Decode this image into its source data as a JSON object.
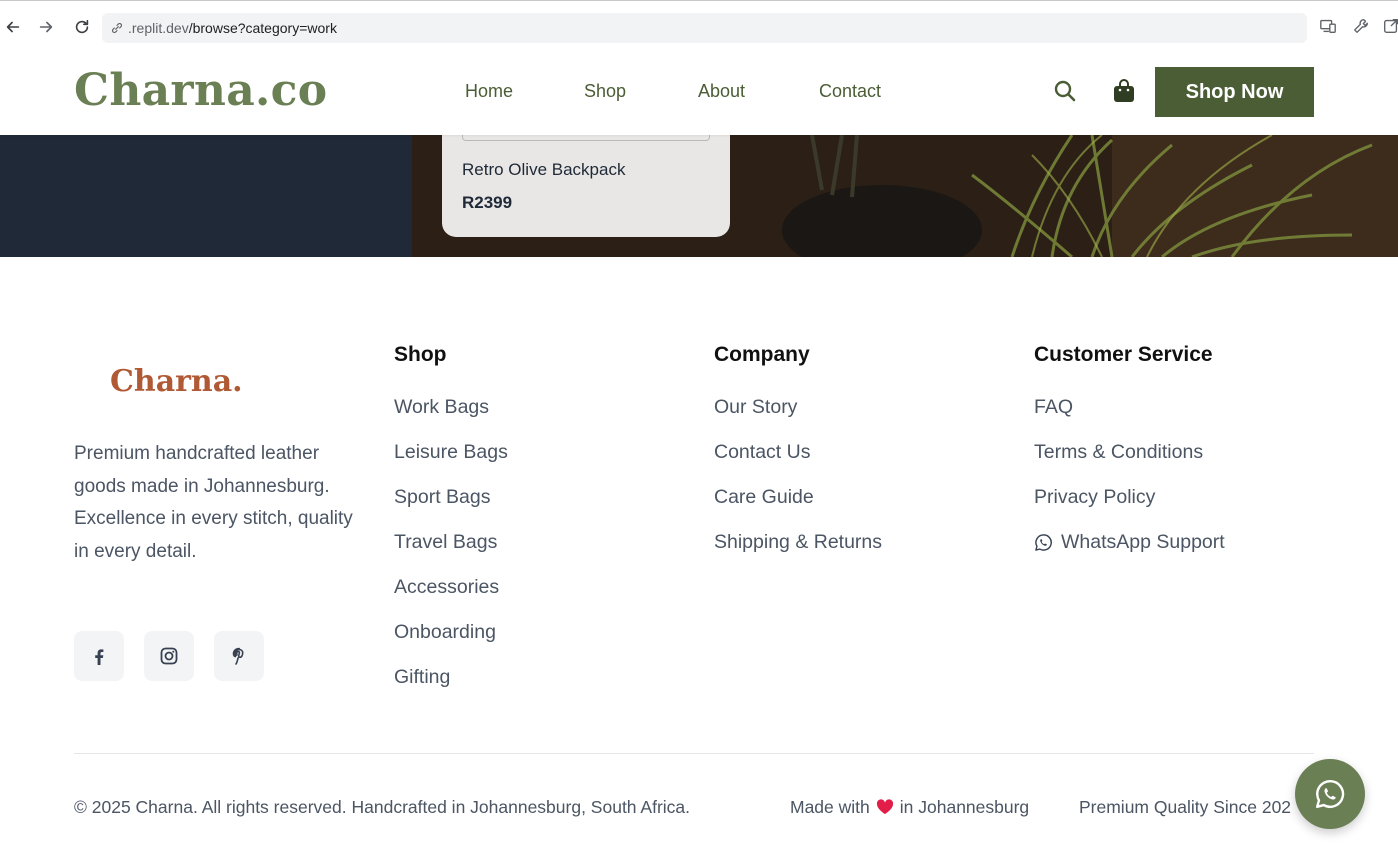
{
  "browser": {
    "url_host": ".replit.dev",
    "url_path": "/browse?category=work"
  },
  "header": {
    "logo": "Charna.co",
    "nav": [
      "Home",
      "Shop",
      "About",
      "Contact"
    ],
    "cta": "Shop Now",
    "icons": [
      "search-icon",
      "shopping-bag-icon"
    ]
  },
  "product_card": {
    "name": "Retro Olive Backpack",
    "price": "R2399"
  },
  "footer": {
    "logo": "Charna.",
    "description": "Premium handcrafted leather goods made in Johannesburg. Excellence in every stitch, quality in every detail.",
    "social": [
      "facebook-icon",
      "instagram-icon",
      "pinterest-icon"
    ],
    "columns": [
      {
        "title": "Shop",
        "links": [
          "Work Bags",
          "Leisure Bags",
          "Sport Bags",
          "Travel Bags",
          "Accessories",
          "Onboarding",
          "Gifting"
        ]
      },
      {
        "title": "Company",
        "links": [
          "Our Story",
          "Contact Us",
          "Care Guide",
          "Shipping & Returns"
        ]
      },
      {
        "title": "Customer Service",
        "links": [
          "FAQ",
          "Terms & Conditions",
          "Privacy Policy",
          "WhatsApp Support"
        ]
      }
    ],
    "copyright": "© 2025 Charna. All rights reserved. Handcrafted in Johannesburg, South Africa.",
    "made_with_prefix": "Made with",
    "made_with_suffix": "in Johannesburg",
    "quality": "Premium Quality Since 202"
  },
  "colors": {
    "brand_green": "#4a5d34",
    "logo_green": "#6b7f55",
    "footer_logo": "#b05a35",
    "hero_dark": "#1f2937",
    "heart": "#e11d48"
  }
}
